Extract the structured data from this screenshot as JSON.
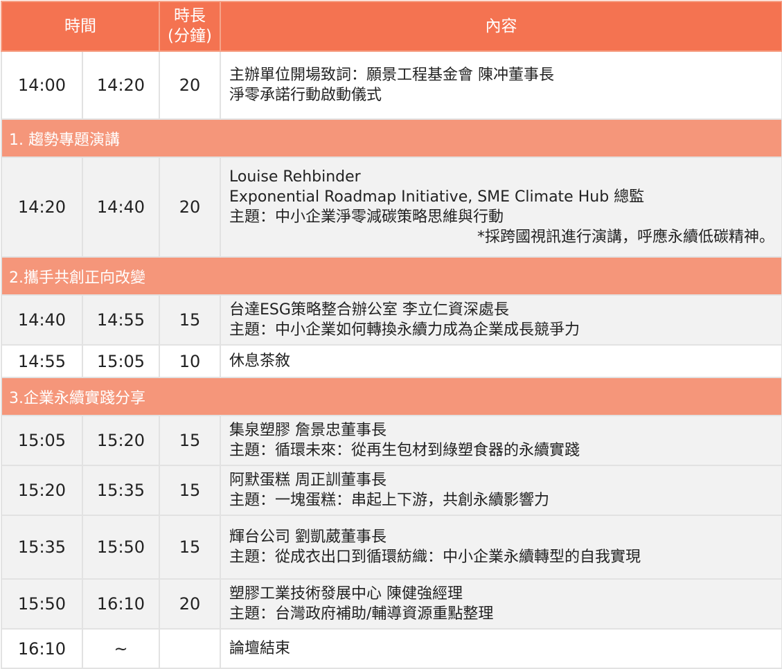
{
  "header": {
    "time": "時間",
    "duration_line1": "時長",
    "duration_line2": "(分鐘)",
    "content": "內容"
  },
  "rows": [
    {
      "kind": "item",
      "shade": "white",
      "start": "14:00",
      "end": "14:20",
      "minutes": "20",
      "lines": [
        "主辦單位開場致詞：願景工程基金會 陳冲董事長",
        "淨零承諾行動啟動儀式"
      ]
    },
    {
      "kind": "section",
      "title": "1. 趨勢專題演講"
    },
    {
      "kind": "item",
      "shade": "gray",
      "start": "14:20",
      "end": "14:40",
      "minutes": "20",
      "lines": [
        "Louise Rehbinder",
        "Exponential Roadmap Initiative, SME Climate Hub 總監",
        "主題：中小企業淨零減碳策略思維與行動"
      ],
      "note": "*採跨國視訊進行演講，呼應永續低碳精神。"
    },
    {
      "kind": "section",
      "title": "2.攜手共創正向改變"
    },
    {
      "kind": "item",
      "shade": "gray",
      "start": "14:40",
      "end": "14:55",
      "minutes": "15",
      "lines": [
        "台達ESG策略整合辦公室  李立仁資深處長",
        "主題：中小企業如何轉換永續力成為企業成長競爭力"
      ]
    },
    {
      "kind": "item",
      "shade": "white",
      "start": "14:55",
      "end": "15:05",
      "minutes": "10",
      "lines": [
        "休息茶敘"
      ]
    },
    {
      "kind": "section",
      "title": "3.企業永續實踐分享"
    },
    {
      "kind": "item",
      "shade": "gray",
      "start": "15:05",
      "end": "15:20",
      "minutes": "15",
      "lines": [
        "集泉塑膠  詹景忠董事長",
        "主題：循環未來：從再生包材到綠塑食器的永續實踐"
      ]
    },
    {
      "kind": "item",
      "shade": "gray",
      "start": "15:20",
      "end": "15:35",
      "minutes": "15",
      "lines": [
        "阿默蛋糕  周正訓董事長",
        "主題：一塊蛋糕：串起上下游，共創永續影響力"
      ]
    },
    {
      "kind": "item",
      "shade": "gray",
      "start": "15:35",
      "end": "15:50",
      "minutes": "15",
      "lines": [
        "輝台公司 劉凱葳董事長",
        "主題：從成衣出口到循環紡織：中小企業永續轉型的自我實現"
      ]
    },
    {
      "kind": "item",
      "shade": "gray",
      "start": "15:50",
      "end": "16:10",
      "minutes": "20",
      "lines": [
        "塑膠工業技術發展中心  陳健強經理",
        "主題：台灣政府補助/輔導資源重點整理"
      ]
    },
    {
      "kind": "item",
      "shade": "white",
      "start": "16:10",
      "end": "~",
      "minutes": "",
      "lines": [
        "論壇結束"
      ]
    }
  ],
  "colors": {
    "header_bg": "#f47351",
    "section_bg": "#f5967a",
    "row_gray": "#f2f2f2",
    "row_white": "#ffffff",
    "border": "#e2e2e2"
  }
}
